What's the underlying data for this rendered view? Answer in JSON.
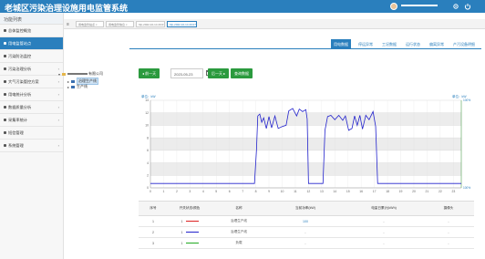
{
  "app": {
    "title": "老城区污染治理设施用电监管系统"
  },
  "sidebar": {
    "title": "功能列表",
    "items": [
      {
        "label": "总体监控概览",
        "active": false,
        "expandable": false
      },
      {
        "label": "用电监管站点",
        "active": true,
        "expandable": false
      },
      {
        "label": "污染防治监控",
        "active": false,
        "expandable": false
      },
      {
        "label": "污染治理分析",
        "active": false,
        "expandable": true
      },
      {
        "label": "大气污染管控方案",
        "active": false,
        "expandable": true
      },
      {
        "label": "用电统计分析",
        "active": false,
        "expandable": true
      },
      {
        "label": "数据质量分析",
        "active": false,
        "expandable": true
      },
      {
        "label": "采集率统计",
        "active": false,
        "expandable": true
      },
      {
        "label": "短信管理",
        "active": false,
        "expandable": false
      },
      {
        "label": "系统管理",
        "active": false,
        "expandable": true
      }
    ]
  },
  "tabs": [
    {
      "label": "用电监管站点 ×",
      "active": false
    },
    {
      "label": "用电监管信息 ×",
      "active": false
    },
    {
      "label": "hfp-2022-10-14 20:07:46 ×",
      "active": false
    },
    {
      "label": "hfp-2022-10-14 20:07:46 ×",
      "active": true
    }
  ],
  "subnav": [
    "用电数据",
    "停运异常",
    "工况数据",
    "运行状态",
    "偏离异常",
    "产污设备明细"
  ],
  "tree": {
    "root": "有限公司",
    "children": [
      "治理生产线",
      "生产线"
    ]
  },
  "toolbar": {
    "prev_label": "前一天",
    "date_value": "2023-05-23",
    "next_label": "后一天",
    "query_label": "查询数据"
  },
  "chart_data": {
    "type": "line",
    "y_left_label": "单位：kW",
    "y_right_label": "单位：kW",
    "x_ticks": [
      0,
      1,
      2,
      3,
      4,
      5,
      6,
      7,
      8,
      9,
      10,
      11,
      12,
      13,
      14,
      15,
      16,
      17,
      18,
      19,
      20,
      21,
      22,
      23
    ],
    "ylim": [
      0,
      14
    ],
    "y_ticks": [
      0,
      2,
      4,
      6,
      8,
      10,
      12,
      14
    ],
    "y_right_ticks": [
      "100%",
      "",
      "",
      "",
      "",
      "",
      "",
      "100%"
    ],
    "right_axis_color": "#2a8a2a",
    "grid": true,
    "series": [
      {
        "color": "#2222cc",
        "points": [
          [
            0,
            0.7
          ],
          [
            1,
            0.7
          ],
          [
            2,
            0.7
          ],
          [
            3,
            0.7
          ],
          [
            4,
            0.7
          ],
          [
            5,
            0.7
          ],
          [
            6,
            0.7
          ],
          [
            7,
            0.7
          ],
          [
            7.9,
            0.7
          ],
          [
            8.05,
            6
          ],
          [
            8.15,
            11.5
          ],
          [
            8.3,
            11.8
          ],
          [
            8.45,
            10.5
          ],
          [
            8.6,
            11.2
          ],
          [
            8.8,
            9.5
          ],
          [
            9,
            11.4
          ],
          [
            9.2,
            9.6
          ],
          [
            9.45,
            11.5
          ],
          [
            9.7,
            9.5
          ],
          [
            10,
            9.8
          ],
          [
            10.3,
            10
          ],
          [
            10.5,
            12.3
          ],
          [
            10.8,
            12.7
          ],
          [
            11.1,
            11.5
          ],
          [
            11.3,
            12.6
          ],
          [
            11.55,
            12.2
          ],
          [
            11.8,
            12.5
          ],
          [
            11.9,
            11
          ],
          [
            12,
            0.7
          ],
          [
            13.1,
            0.7
          ],
          [
            13.25,
            9.2
          ],
          [
            13.45,
            11.4
          ],
          [
            13.7,
            11.6
          ],
          [
            14,
            10.9
          ],
          [
            14.3,
            11.6
          ],
          [
            14.6,
            10.8
          ],
          [
            14.8,
            11.5
          ],
          [
            15.05,
            9.2
          ],
          [
            15.3,
            9.5
          ],
          [
            15.5,
            11.5
          ],
          [
            15.7,
            10
          ],
          [
            15.9,
            11.6
          ],
          [
            16.1,
            9.4
          ],
          [
            16.35,
            11.6
          ],
          [
            16.6,
            10.9
          ],
          [
            16.9,
            12.2
          ],
          [
            17.1,
            9.8
          ],
          [
            17.25,
            0.7
          ],
          [
            23.6,
            0.7
          ]
        ]
      }
    ]
  },
  "table": {
    "headers": [
      "序号",
      "开关状态/颜色",
      "名称",
      "当前功率(kW)",
      "电量日累计(kWh)",
      "摄像头"
    ],
    "rows": [
      {
        "no": "1",
        "status": "1",
        "color": "#dd2222",
        "name": "治理生产线",
        "power": "100",
        "energy": "-",
        "camera": "-"
      },
      {
        "no": "2",
        "status": "1",
        "color": "#2222cc",
        "name": "治理生产线",
        "power": "-",
        "energy": "-",
        "camera": "-"
      },
      {
        "no": "3",
        "status": "1",
        "color": "#22aa22",
        "name": "负载",
        "power": "-",
        "energy": "-",
        "camera": "-"
      }
    ]
  }
}
